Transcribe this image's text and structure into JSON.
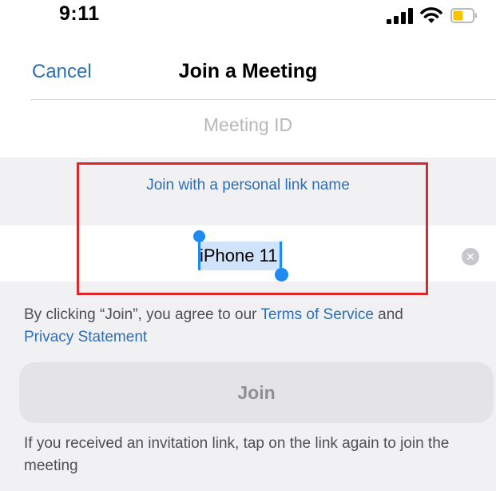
{
  "status_bar": {
    "time": "9:11",
    "icons": [
      "signal-icon",
      "wifi-icon",
      "battery-icon"
    ],
    "battery_color": "#f5c400"
  },
  "nav": {
    "cancel_label": "Cancel",
    "title": "Join a Meeting"
  },
  "meeting_id": {
    "placeholder": "Meeting ID"
  },
  "personal_link_label": "Join with a personal link name",
  "name_field": {
    "value": "iPhone 11"
  },
  "terms": {
    "prefix": "By clicking “Join”, you agree to our ",
    "terms_link": "Terms of Service",
    "middle": " and ",
    "privacy_link": "Privacy Statement"
  },
  "join_button": {
    "label": "Join"
  },
  "invite_note": "If you received an invitation link, tap on the link again to join the meeting",
  "colors": {
    "accent": "#2a6fb7",
    "highlight": "#e0262b",
    "selection": "#cfe3fb",
    "handle": "#1f8af2"
  }
}
